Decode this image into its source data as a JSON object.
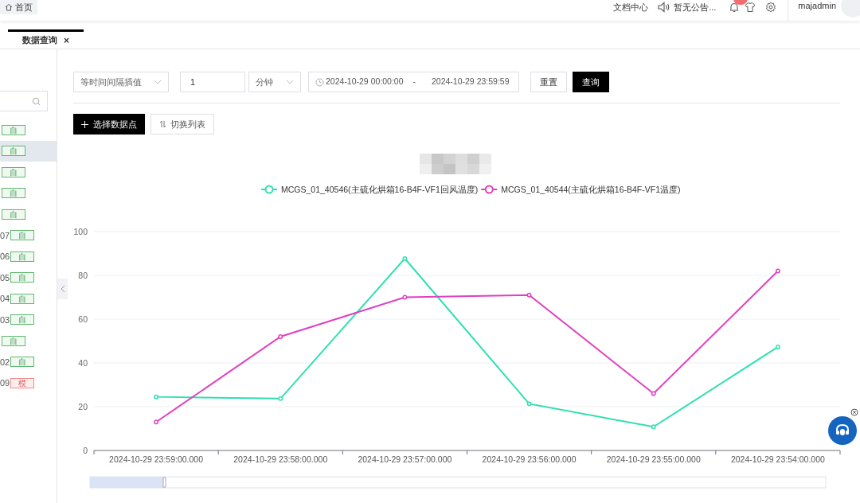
{
  "header": {
    "home_tab": "首页",
    "docs": "文档中心",
    "notice": "暂无公告...",
    "user": "majadmin"
  },
  "tabs": [
    {
      "label": "数据查询",
      "selected": true,
      "close": "×"
    }
  ],
  "sidebar": {
    "items": [
      {
        "tag": "自",
        "kind": "auto",
        "selected": false
      },
      {
        "tag": "自",
        "kind": "auto",
        "selected": true
      },
      {
        "tag": "自",
        "kind": "auto",
        "selected": false
      },
      {
        "tag": "自",
        "kind": "auto",
        "selected": false
      },
      {
        "tag": "自",
        "kind": "auto",
        "selected": false
      },
      {
        "text": "07",
        "tag": "自",
        "kind": "auto",
        "selected": false
      },
      {
        "text": "06",
        "tag": "自",
        "kind": "auto",
        "selected": false
      },
      {
        "text": "05",
        "tag": "自",
        "kind": "auto",
        "selected": false
      },
      {
        "text": "04",
        "tag": "自",
        "kind": "auto",
        "selected": false
      },
      {
        "text": "03",
        "tag": "自",
        "kind": "auto",
        "selected": false
      },
      {
        "tag": "自",
        "kind": "auto",
        "selected": false
      },
      {
        "text": "02",
        "tag": "自",
        "kind": "auto",
        "selected": false
      },
      {
        "text": "09",
        "tag": "模",
        "kind": "model",
        "selected": false
      }
    ]
  },
  "filters": {
    "mode": "等时间间隔插值",
    "interval": "1",
    "unit": "分钟",
    "start": "2024-10-29 00:00:00",
    "separator": "-",
    "end": "2024-10-29 23:59:59",
    "reset": "重置",
    "query": "查询"
  },
  "actions": {
    "select_points": "选择数据点",
    "toggle_list": "切换列表"
  },
  "chart": {
    "chart_data": {
      "type": "line",
      "categories": [
        "2024-10-29 23:59:00.000",
        "2024-10-29 23:58:00.000",
        "2024-10-29 23:57:00.000",
        "2024-10-29 23:56:00.000",
        "2024-10-29 23:55:00.000",
        "2024-10-29 23:54:00.000"
      ],
      "series": [
        {
          "name": "MCGS_01_40546(主硫化烘箱16-B4F-VF1回风温度)",
          "color": "#2ee0b0",
          "marker": "circle",
          "values": [
            24.5,
            23.7,
            87.7,
            21.3,
            10.8,
            47.3
          ]
        },
        {
          "name": "MCGS_01_40544(主硫化烘箱16-B4F-VF1温度)",
          "color": "#e040c0",
          "marker": "circle",
          "values": [
            13,
            52,
            70,
            71,
            26,
            82
          ]
        }
      ],
      "ylim": [
        0,
        100
      ],
      "yticks": [
        0,
        20,
        40,
        60,
        80,
        100
      ],
      "grid": true,
      "legend": true
    }
  }
}
